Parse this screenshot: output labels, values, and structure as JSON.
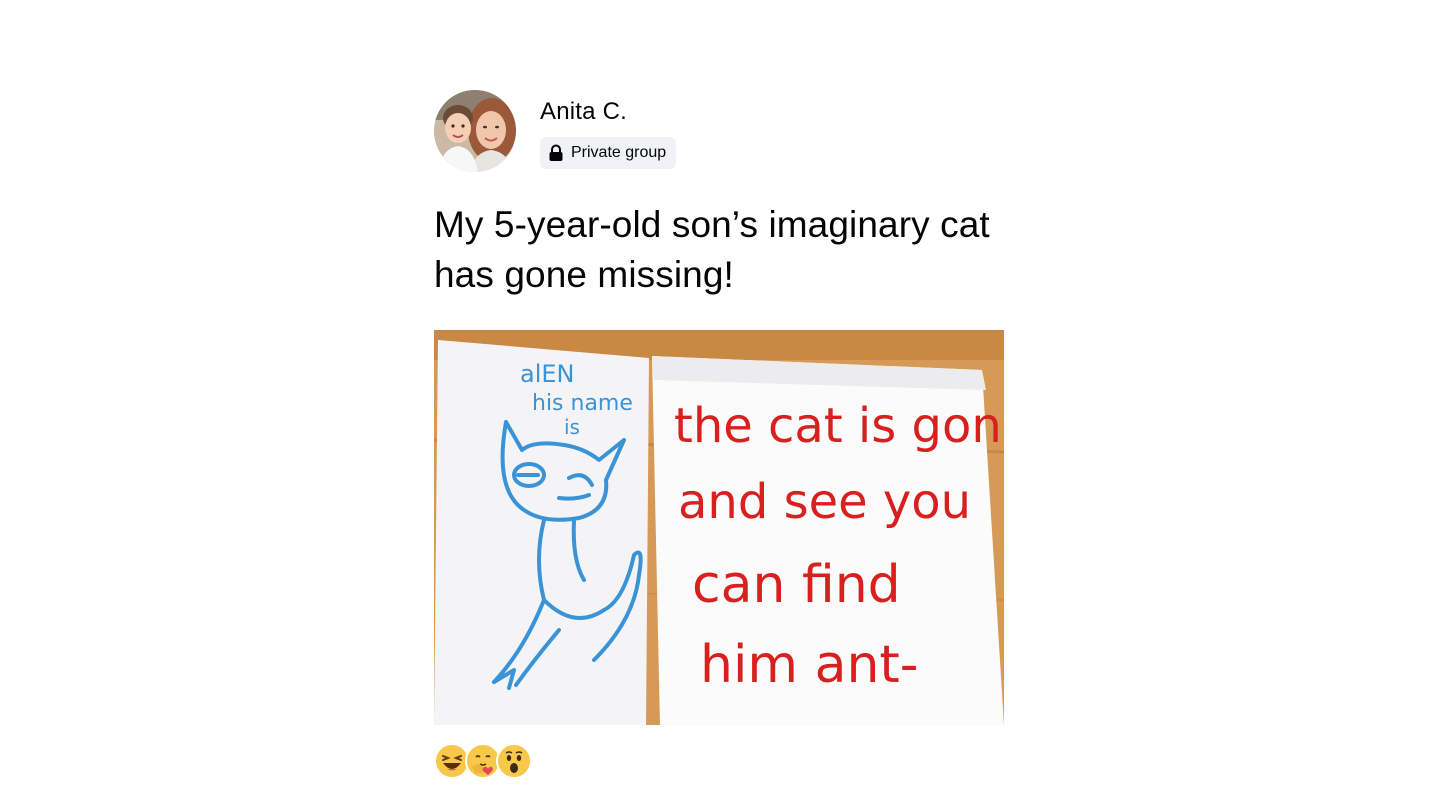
{
  "post": {
    "author_name": "Anita C.",
    "privacy_label": "Private group",
    "title": "My 5-year-old son’s imaginary cat has gone missing!",
    "photo": {
      "left_sheet_text": [
        "alEN",
        "his name",
        "is"
      ],
      "right_sheet_text": [
        "the cat is gone",
        "and see you",
        "can find",
        "him ant-"
      ]
    },
    "reactions": [
      "haha-icon",
      "care-icon",
      "wow-icon"
    ]
  },
  "colors": {
    "text": "#050505",
    "badge_bg": "#f0f2f5",
    "table_wood": "#d79a56",
    "blue_marker": "#3a93d6",
    "red_marker": "#d8201f",
    "reaction_yellow": "#f7c84a"
  }
}
